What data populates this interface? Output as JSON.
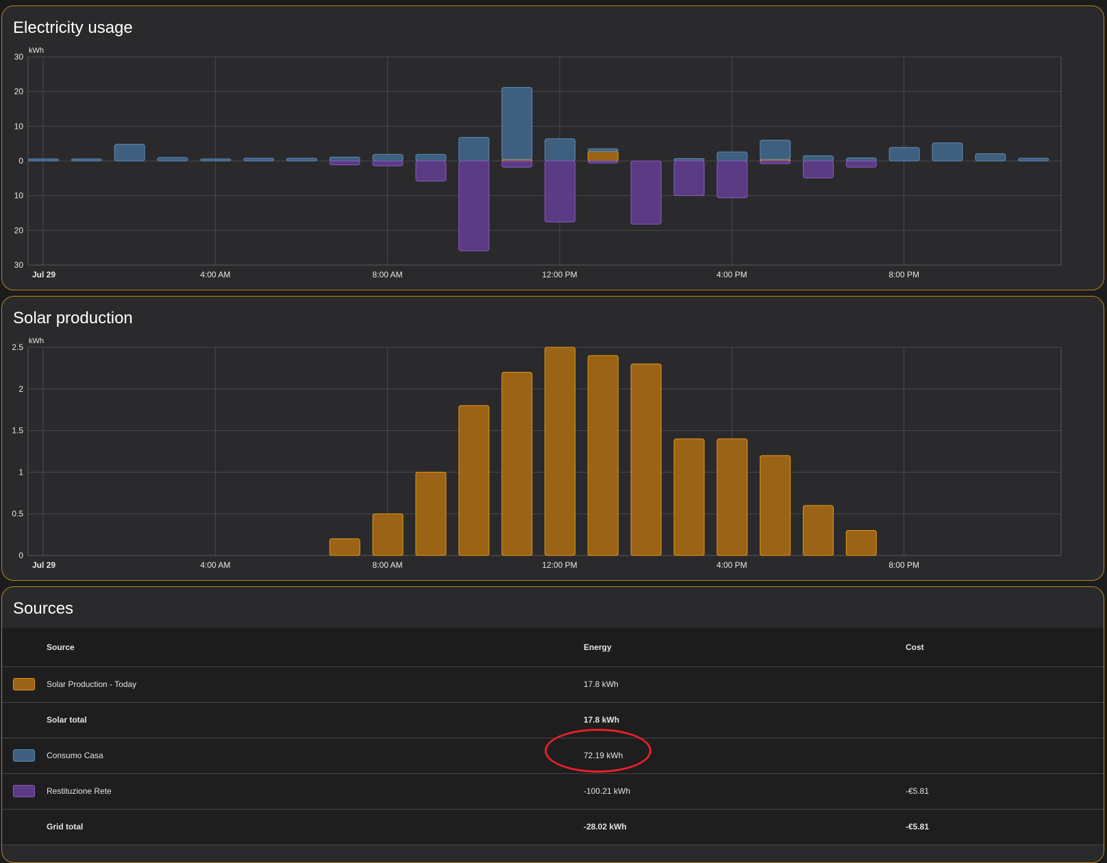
{
  "colors": {
    "border": "#b8861b",
    "card": "#2a2a2c",
    "grid_consumption": "#3f5f7f",
    "grid_return": "#5b3b84",
    "solar": "#9a6315",
    "solar_border": "#e89a18",
    "highlight": "#e8202a"
  },
  "usage": {
    "title": "Electricity usage",
    "unit": "kWh",
    "chart_data": {
      "type": "bar",
      "categories": [
        "0",
        "1",
        "2",
        "3",
        "4",
        "5",
        "6",
        "7",
        "8",
        "9",
        "10",
        "11",
        "12",
        "13",
        "14",
        "15",
        "16",
        "17",
        "18",
        "19",
        "20",
        "21",
        "22",
        "23"
      ],
      "series": [
        {
          "name": "Solar Production - Today",
          "values": [
            0,
            0,
            0,
            0,
            0,
            0,
            0,
            0,
            0,
            0,
            0,
            0.5,
            0,
            2.8,
            0,
            0,
            0,
            0.5,
            0,
            0,
            0,
            0,
            0,
            0
          ]
        },
        {
          "name": "Consumo Casa",
          "values": [
            0.6,
            0.6,
            4.8,
            1,
            0.6,
            0.8,
            0.8,
            1.1,
            1.9,
            1.9,
            6.8,
            20.7,
            6.4,
            0.7,
            0,
            0.7,
            2.6,
            5.5,
            1.5,
            0.9,
            3.9,
            5.2,
            2.1,
            0.8
          ]
        },
        {
          "name": "Restituzione Rete",
          "values": [
            0,
            0,
            0,
            0,
            0,
            0,
            0,
            -1.1,
            -1.4,
            -5.8,
            -25.9,
            -1.8,
            -17.6,
            -0.6,
            -18.2,
            -10,
            -10.6,
            -0.8,
            -4.9,
            -1.8,
            0,
            0,
            0,
            0
          ]
        }
      ],
      "ylim": [
        -30,
        30
      ],
      "yticks": [
        "30",
        "20",
        "10",
        "0",
        "10",
        "20",
        "30"
      ],
      "xticks": [
        "Jul 29",
        "4:00 AM",
        "8:00 AM",
        "12:00 PM",
        "4:00 PM",
        "8:00 PM"
      ],
      "grid": true
    }
  },
  "solar": {
    "title": "Solar production",
    "unit": "kWh",
    "chart_data": {
      "type": "bar",
      "categories": [
        "0",
        "1",
        "2",
        "3",
        "4",
        "5",
        "6",
        "7",
        "8",
        "9",
        "10",
        "11",
        "12",
        "13",
        "14",
        "15",
        "16",
        "17",
        "18",
        "19",
        "20",
        "21",
        "22",
        "23"
      ],
      "values": [
        0,
        0,
        0,
        0,
        0,
        0,
        0,
        0.2,
        0.5,
        1.0,
        1.8,
        2.2,
        2.5,
        2.4,
        2.3,
        1.4,
        1.4,
        1.2,
        0.6,
        0.3,
        0,
        0,
        0,
        0
      ],
      "ylim": [
        0,
        2.5
      ],
      "yticks": [
        "2.5",
        "2",
        "1.5",
        "1",
        "0.5",
        "0"
      ],
      "xticks": [
        "Jul 29",
        "4:00 AM",
        "8:00 AM",
        "12:00 PM",
        "4:00 PM",
        "8:00 PM"
      ],
      "grid": true
    }
  },
  "sources": {
    "title": "Sources",
    "headers": {
      "source": "Source",
      "energy": "Energy",
      "cost": "Cost"
    },
    "rows": [
      {
        "source": "Solar Production - Today",
        "energy": "17.8 kWh",
        "cost": ""
      },
      {
        "source": "Solar total",
        "energy": "17.8 kWh",
        "cost": ""
      },
      {
        "source": "Consumo Casa",
        "energy": "72.19 kWh",
        "cost": ""
      },
      {
        "source": "Restituzione Rete",
        "energy": "-100.21 kWh",
        "cost": "-€5.81"
      },
      {
        "source": "Grid total",
        "energy": "-28.02 kWh",
        "cost": "-€5.81"
      }
    ]
  }
}
